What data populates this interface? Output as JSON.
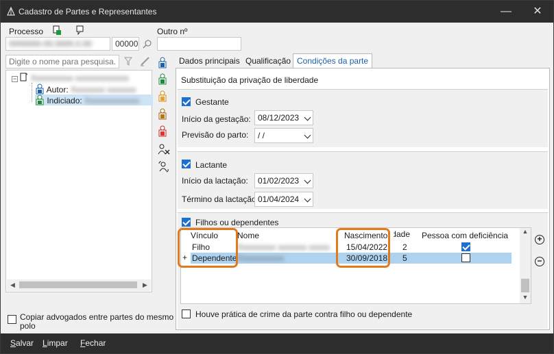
{
  "window": {
    "title": "Cadastro de Partes e Representantes",
    "minimize_glyph": "—",
    "close_glyph": "✕"
  },
  "header": {
    "processo_label": "Processo",
    "processo_value_masked": "0000000-00.0000.0.00",
    "processo_suffix": "00000",
    "outro_label": "Outro nº",
    "outro_value": ""
  },
  "search": {
    "placeholder": "Digite o nome para pesquisa..."
  },
  "tree": {
    "root_masked": "Xxxxxxxxxx xxxxxxxxxxxxx",
    "children": [
      {
        "prefix": "Autor:",
        "masked": " Xxxxxxxx xxxxxxx"
      },
      {
        "prefix": "Indiciado:",
        "masked": " Xxxxxxxxxxxxx"
      }
    ]
  },
  "copy_lawyers": {
    "label_line1": "Copiar advogados entre partes do mesmo",
    "label_line2": "polo",
    "checked": false
  },
  "tabs": [
    {
      "label": "Dados principais",
      "active": false
    },
    {
      "label": "Qualificação",
      "active": false
    },
    {
      "label": "Condições da parte",
      "active": true
    }
  ],
  "conditions": {
    "section_title": "Substituição da privação de liberdade",
    "gestante": {
      "label": "Gestante",
      "checked": true,
      "inicio_label": "Início da gestação:",
      "inicio_value": "08/12/2023",
      "previsao_label": "Previsão do parto:",
      "previsao_value": " /  /"
    },
    "lactante": {
      "label": "Lactante",
      "checked": true,
      "inicio_label": "Início da lactação:",
      "inicio_value": "01/02/2023",
      "termino_label": "Término da lactação:",
      "termino_value": "01/04/2024"
    },
    "filhos": {
      "label": "Filhos ou dependentes",
      "checked": true,
      "columns": [
        "Vínculo",
        "Nome",
        "Nascimento",
        "Idade",
        "Pessoa com deficiência"
      ],
      "rows": [
        {
          "vinculo": "Filho",
          "nome": "Xxxxxxxxx xxxxxxx xxxxx",
          "nascimento": "15/04/2022",
          "idade": "2",
          "pcd": true,
          "marker": ""
        },
        {
          "vinculo": "Dependente",
          "nome": "Xxxxxxxxxxx",
          "nascimento": "30/09/2018",
          "idade": "5",
          "pcd": false,
          "marker": "+"
        }
      ],
      "add_glyph": "+",
      "remove_glyph": "−"
    },
    "crime": {
      "label": "Houve prática de crime da parte contra filho ou dependente",
      "checked": false
    }
  },
  "footer": {
    "salvar": {
      "u": "S",
      "rest": "alvar"
    },
    "limpar": {
      "u": "L",
      "rest": "impar"
    },
    "fechar": {
      "u": "F",
      "rest": "echar"
    }
  },
  "colors": {
    "titlebar": "#2d2d2d",
    "accent": "#1f6fd1",
    "highlight": "#e07a1a",
    "selected_row": "#aed3f0"
  }
}
